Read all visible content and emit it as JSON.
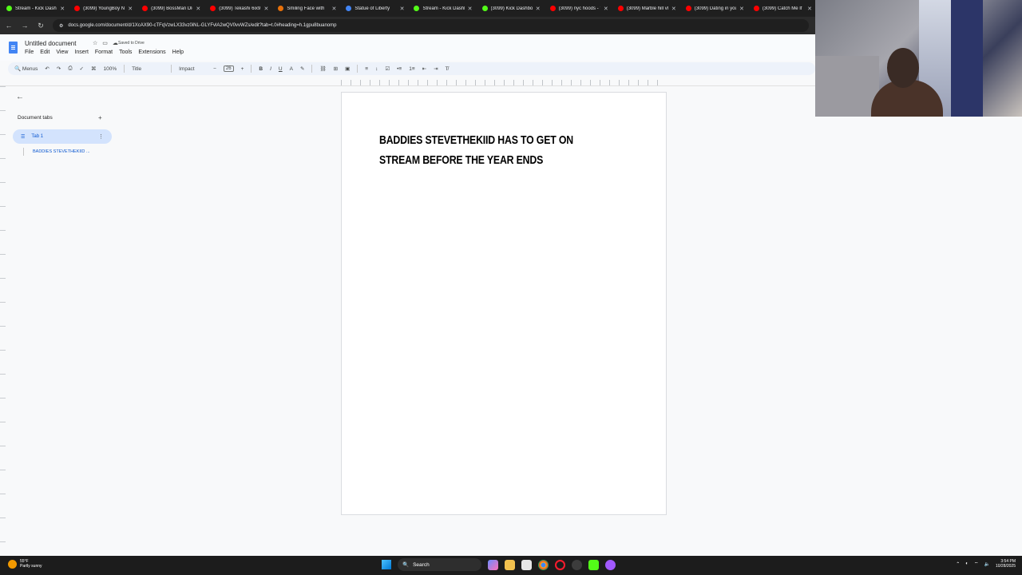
{
  "browser": {
    "tabs": [
      {
        "title": "Stream - Kick Dashbo",
        "color": "#53fc18"
      },
      {
        "title": "(3099) YoungBoy Nev",
        "color": "#ff0000"
      },
      {
        "title": "(3099) BossMan Dlow",
        "color": "#ff0000"
      },
      {
        "title": "(3099) Tekashi 6ix9ine",
        "color": "#ff0000"
      },
      {
        "title": "Smiling Face with",
        "color": "#e8710a"
      },
      {
        "title": "Statue of Liberty",
        "color": "#4285f4"
      },
      {
        "title": "Stream - Kick Dashbo",
        "color": "#53fc18"
      },
      {
        "title": "(3099) Kick Dashbo",
        "color": "#53fc18"
      },
      {
        "title": "(3099) nyc hoods - Yo",
        "color": "#ff0000"
      },
      {
        "title": "(3099) Marble hill vlo",
        "color": "#ff0000"
      },
      {
        "title": "(3099) Dating in your",
        "color": "#ff0000"
      },
      {
        "title": "(3099) Catch Me If",
        "color": "#ff0000"
      }
    ],
    "url": "docs.google.com/document/d/1XcAX90-cTFqVzwLX33vz0iNL-GLYFvlA2wQV0vvWZs/edit?tab=t.0#heading=h.1gpu8buanomp",
    "nav": {
      "back": "←",
      "forward": "→",
      "reload": "↻",
      "tune": "⚙"
    }
  },
  "docs": {
    "title": "Untitled document",
    "saved_status": "Saved to Drive",
    "star_icon": "☆",
    "move_icon": "▭",
    "cloud_icon": "☁",
    "menu": [
      "File",
      "Edit",
      "View",
      "Insert",
      "Format",
      "Tools",
      "Extensions",
      "Help"
    ],
    "toolbar": {
      "menus_label": "Menus",
      "zoom": "100%",
      "style": "Title",
      "font": "Impact",
      "font_size": "26",
      "bold": "B",
      "italic": "I",
      "underline": "U",
      "text_color": "A"
    }
  },
  "sidebar": {
    "back_arrow": "←",
    "header": "Document tabs",
    "add": "+",
    "tab_name": "Tab 1",
    "tab_icon": "☰",
    "kebab": "⋮",
    "outline_item": "BADDIES STEVETHEKIID ..."
  },
  "document": {
    "heading": "BADDIES STEVETHEKIID HAS TO GET ON STREAM BEFORE THE YEAR ENDS"
  },
  "taskbar": {
    "weather_temp": "55°F",
    "weather_desc": "Partly sunny",
    "search": "Search",
    "time": "3:54 PM",
    "date": "10/28/2025"
  }
}
